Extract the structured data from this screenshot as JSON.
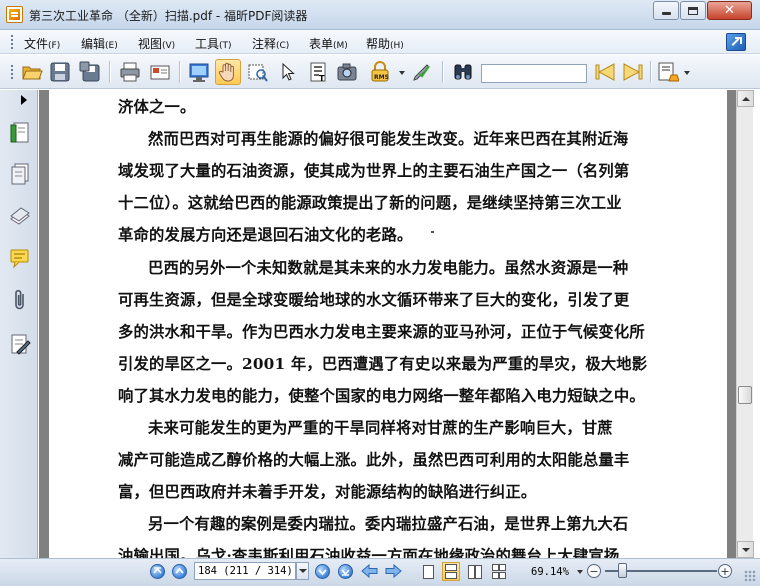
{
  "window": {
    "title": "第三次工业革命 （全新）扫描.pdf - 福昕PDF阅读器",
    "close_symbol": "✕"
  },
  "menu": [
    {
      "label": "文件",
      "accel": "(F)"
    },
    {
      "label": "编辑",
      "accel": "(E)"
    },
    {
      "label": "视图",
      "accel": "(V)"
    },
    {
      "label": "工具",
      "accel": "(T)"
    },
    {
      "label": "注释",
      "accel": "(C)"
    },
    {
      "label": "表单",
      "accel": "(M)"
    },
    {
      "label": "帮助",
      "accel": "(H)"
    }
  ],
  "toolbar": {
    "icons": [
      "open-icon",
      "save-icon",
      "save-as-icon",
      "print-icon",
      "email-icon",
      "fullscreen-icon",
      "hand-tool-icon",
      "snapshot-icon",
      "select-arrow-icon",
      "text-select-icon",
      "image-select-icon",
      "rms-lock-icon",
      "sign-icon",
      "find-binoculars-icon",
      "find-prev-icon",
      "find-next-icon",
      "highlight-icon"
    ],
    "active_tool": "hand-tool-icon",
    "rms_label": "RMS",
    "search_value": ""
  },
  "sidebar": {
    "icons": [
      "bookmarks-icon",
      "pages-icon",
      "layers-icon",
      "comments-icon",
      "attachments-icon",
      "signatures-icon"
    ]
  },
  "document": {
    "lines": [
      "济体之一。",
      "然而巴西对可再生能源的偏好很可能发生改变。近年来巴西在其附近海",
      "域发现了大量的石油资源，使其成为世界上的主要石油生产国之一（名列第",
      "十二位）。这就给巴西的能源政策提出了新的问题，是继续坚持第三次工业",
      "革命的发展方向还是退回石油文化的老路。",
      "巴西的另外一个未知数就是其未来的水力发电能力。虽然水资源是一种",
      "可再生资源，但是全球变暖给地球的水文循环带来了巨大的变化，引发了更",
      "多的洪水和干旱。作为巴西水力发电主要来源的亚马孙河，正位于气候变化所",
      "引发的旱区之一。2001 年，巴西遭遇了有史以来最为严重的旱灾，极大地影",
      "响了其水力发电的能力，使整个国家的电力网络一整年都陷入电力短缺之中。",
      "未来可能发生的更为严重的干旱同样将对甘蔗的生产影响巨大，甘蔗",
      "减产可能造成乙醇价格的大幅上涨。此外，虽然巴西可利用的太阳能总量丰",
      "富，但巴西政府并未着手开发，对能源结构的缺陷进行纠正。",
      "另一个有趣的案例是委内瑞拉。委内瑞拉盛产石油，是世界上第九大石",
      "油输出国。乌戈·查韦斯利用石油收益一方面在地缘政治的舞台上大肆宣扬"
    ]
  },
  "statusbar": {
    "page_display": "184 (211 / 314)",
    "zoom": "69.14%",
    "zoom_out_symbol": "−",
    "zoom_in_symbol": "+"
  },
  "colors": {
    "doc_background": "#808080",
    "chrome": "#dfe7f1",
    "active_tool": "#ffca55"
  }
}
